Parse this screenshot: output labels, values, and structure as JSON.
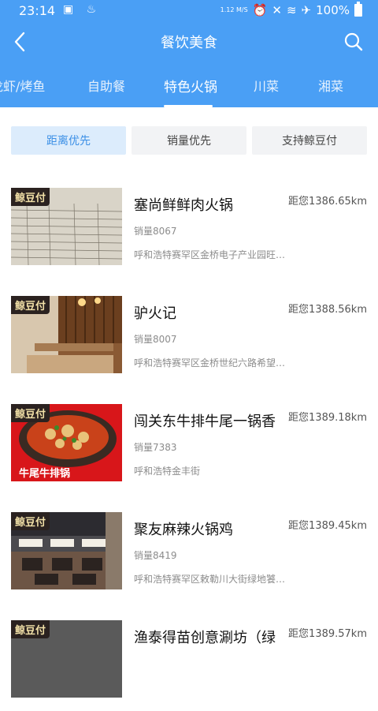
{
  "status_bar": {
    "time": "23:14",
    "network": "1.12 M/S",
    "battery": "100%"
  },
  "nav": {
    "title": "餐饮美食",
    "back_icon": "back-arrow-icon",
    "search_icon": "search-icon"
  },
  "tabs": [
    {
      "label": "龙虾/烤鱼",
      "active": false
    },
    {
      "label": "自助餐",
      "active": false
    },
    {
      "label": "特色火锅",
      "active": true
    },
    {
      "label": "川菜",
      "active": false
    },
    {
      "label": "湘菜",
      "active": false
    }
  ],
  "filters": [
    {
      "label": "距离优先",
      "active": true
    },
    {
      "label": "销量优先",
      "active": false
    },
    {
      "label": "支持鲸豆付",
      "active": false
    }
  ],
  "colors": {
    "header": "#4a9ff5",
    "filter_active_bg": "#dcecfc",
    "filter_active_text": "#3b8fe6"
  },
  "restaurants": [
    {
      "badge": "鲸豆付",
      "name": "塞尚鲜鲜肉火锅",
      "distance": "距您1386.65km",
      "sales": "销量8067",
      "address": "呼和浩特赛罕区金桥电子产业园旺…"
    },
    {
      "badge": "鲸豆付",
      "name": "驴火记",
      "distance": "距您1388.56km",
      "sales": "销量8007",
      "address": "呼和浩特赛罕区金桥世纪六路希望…"
    },
    {
      "badge": "鲸豆付",
      "name": "闯关东牛排牛尾一锅香",
      "distance": "距您1389.18km",
      "sales": "销量7383",
      "address": "呼和浩特金丰街",
      "caption": "牛尾牛排锅"
    },
    {
      "badge": "鲸豆付",
      "name": "聚友麻辣火锅鸡",
      "distance": "距您1389.45km",
      "sales": "销量8419",
      "address": "呼和浩特赛罕区敕勒川大街绿地饕…"
    },
    {
      "badge": "鲸豆付",
      "name": "渔泰得苗创意涮坊（绿",
      "distance": "距您1389.57km",
      "sales": "",
      "address": ""
    }
  ]
}
